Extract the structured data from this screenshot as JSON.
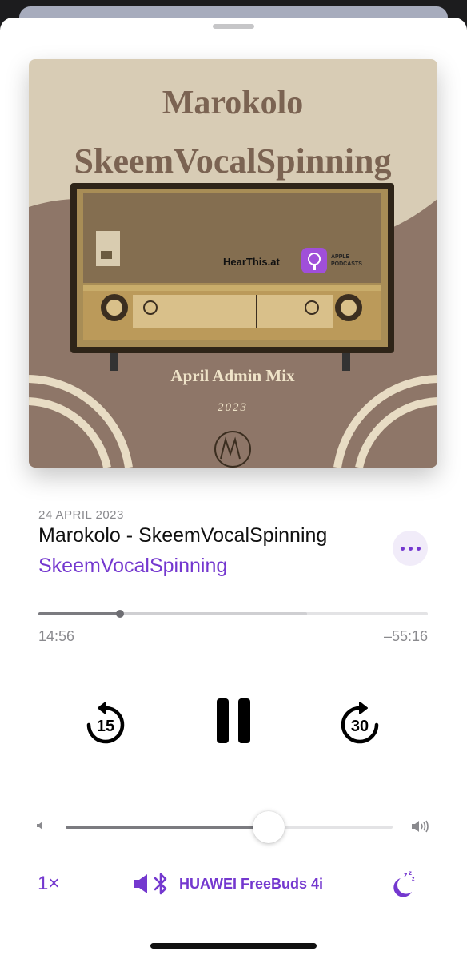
{
  "artwork": {
    "title_line1": "Marokolo",
    "title_line2": "SkeemVocalSpinning",
    "hearthis_text": "HearThis.at",
    "apple_text_line1": "APPLE",
    "apple_text_line2": "PODCASTS",
    "mix_name": "April Admin Mix",
    "year": "2023"
  },
  "episode": {
    "date": "24 APRIL 2023",
    "title": "Marokolo - SkeemVocalSpinning",
    "show": "SkeemVocalSpinning"
  },
  "playback": {
    "elapsed": "14:56",
    "remaining": "–55:16",
    "progress_fraction": 0.21,
    "buffered_fraction": 0.69,
    "skip_back_seconds": "15",
    "skip_forward_seconds": "30",
    "volume_fraction": 0.62
  },
  "bottom_bar": {
    "speed": "1×",
    "output_device": "HUAWEI FreeBuds 4i"
  },
  "colors": {
    "accent": "#7438cf",
    "art_background": "#d8ccb5",
    "art_wave": "#8e7668"
  },
  "icons": [
    "speaker-low-icon",
    "speaker-high-icon",
    "speaker-icon",
    "bluetooth-icon",
    "moon-sleep-icon",
    "more-icon",
    "skip-back-icon",
    "skip-forward-icon",
    "pause-icon"
  ]
}
